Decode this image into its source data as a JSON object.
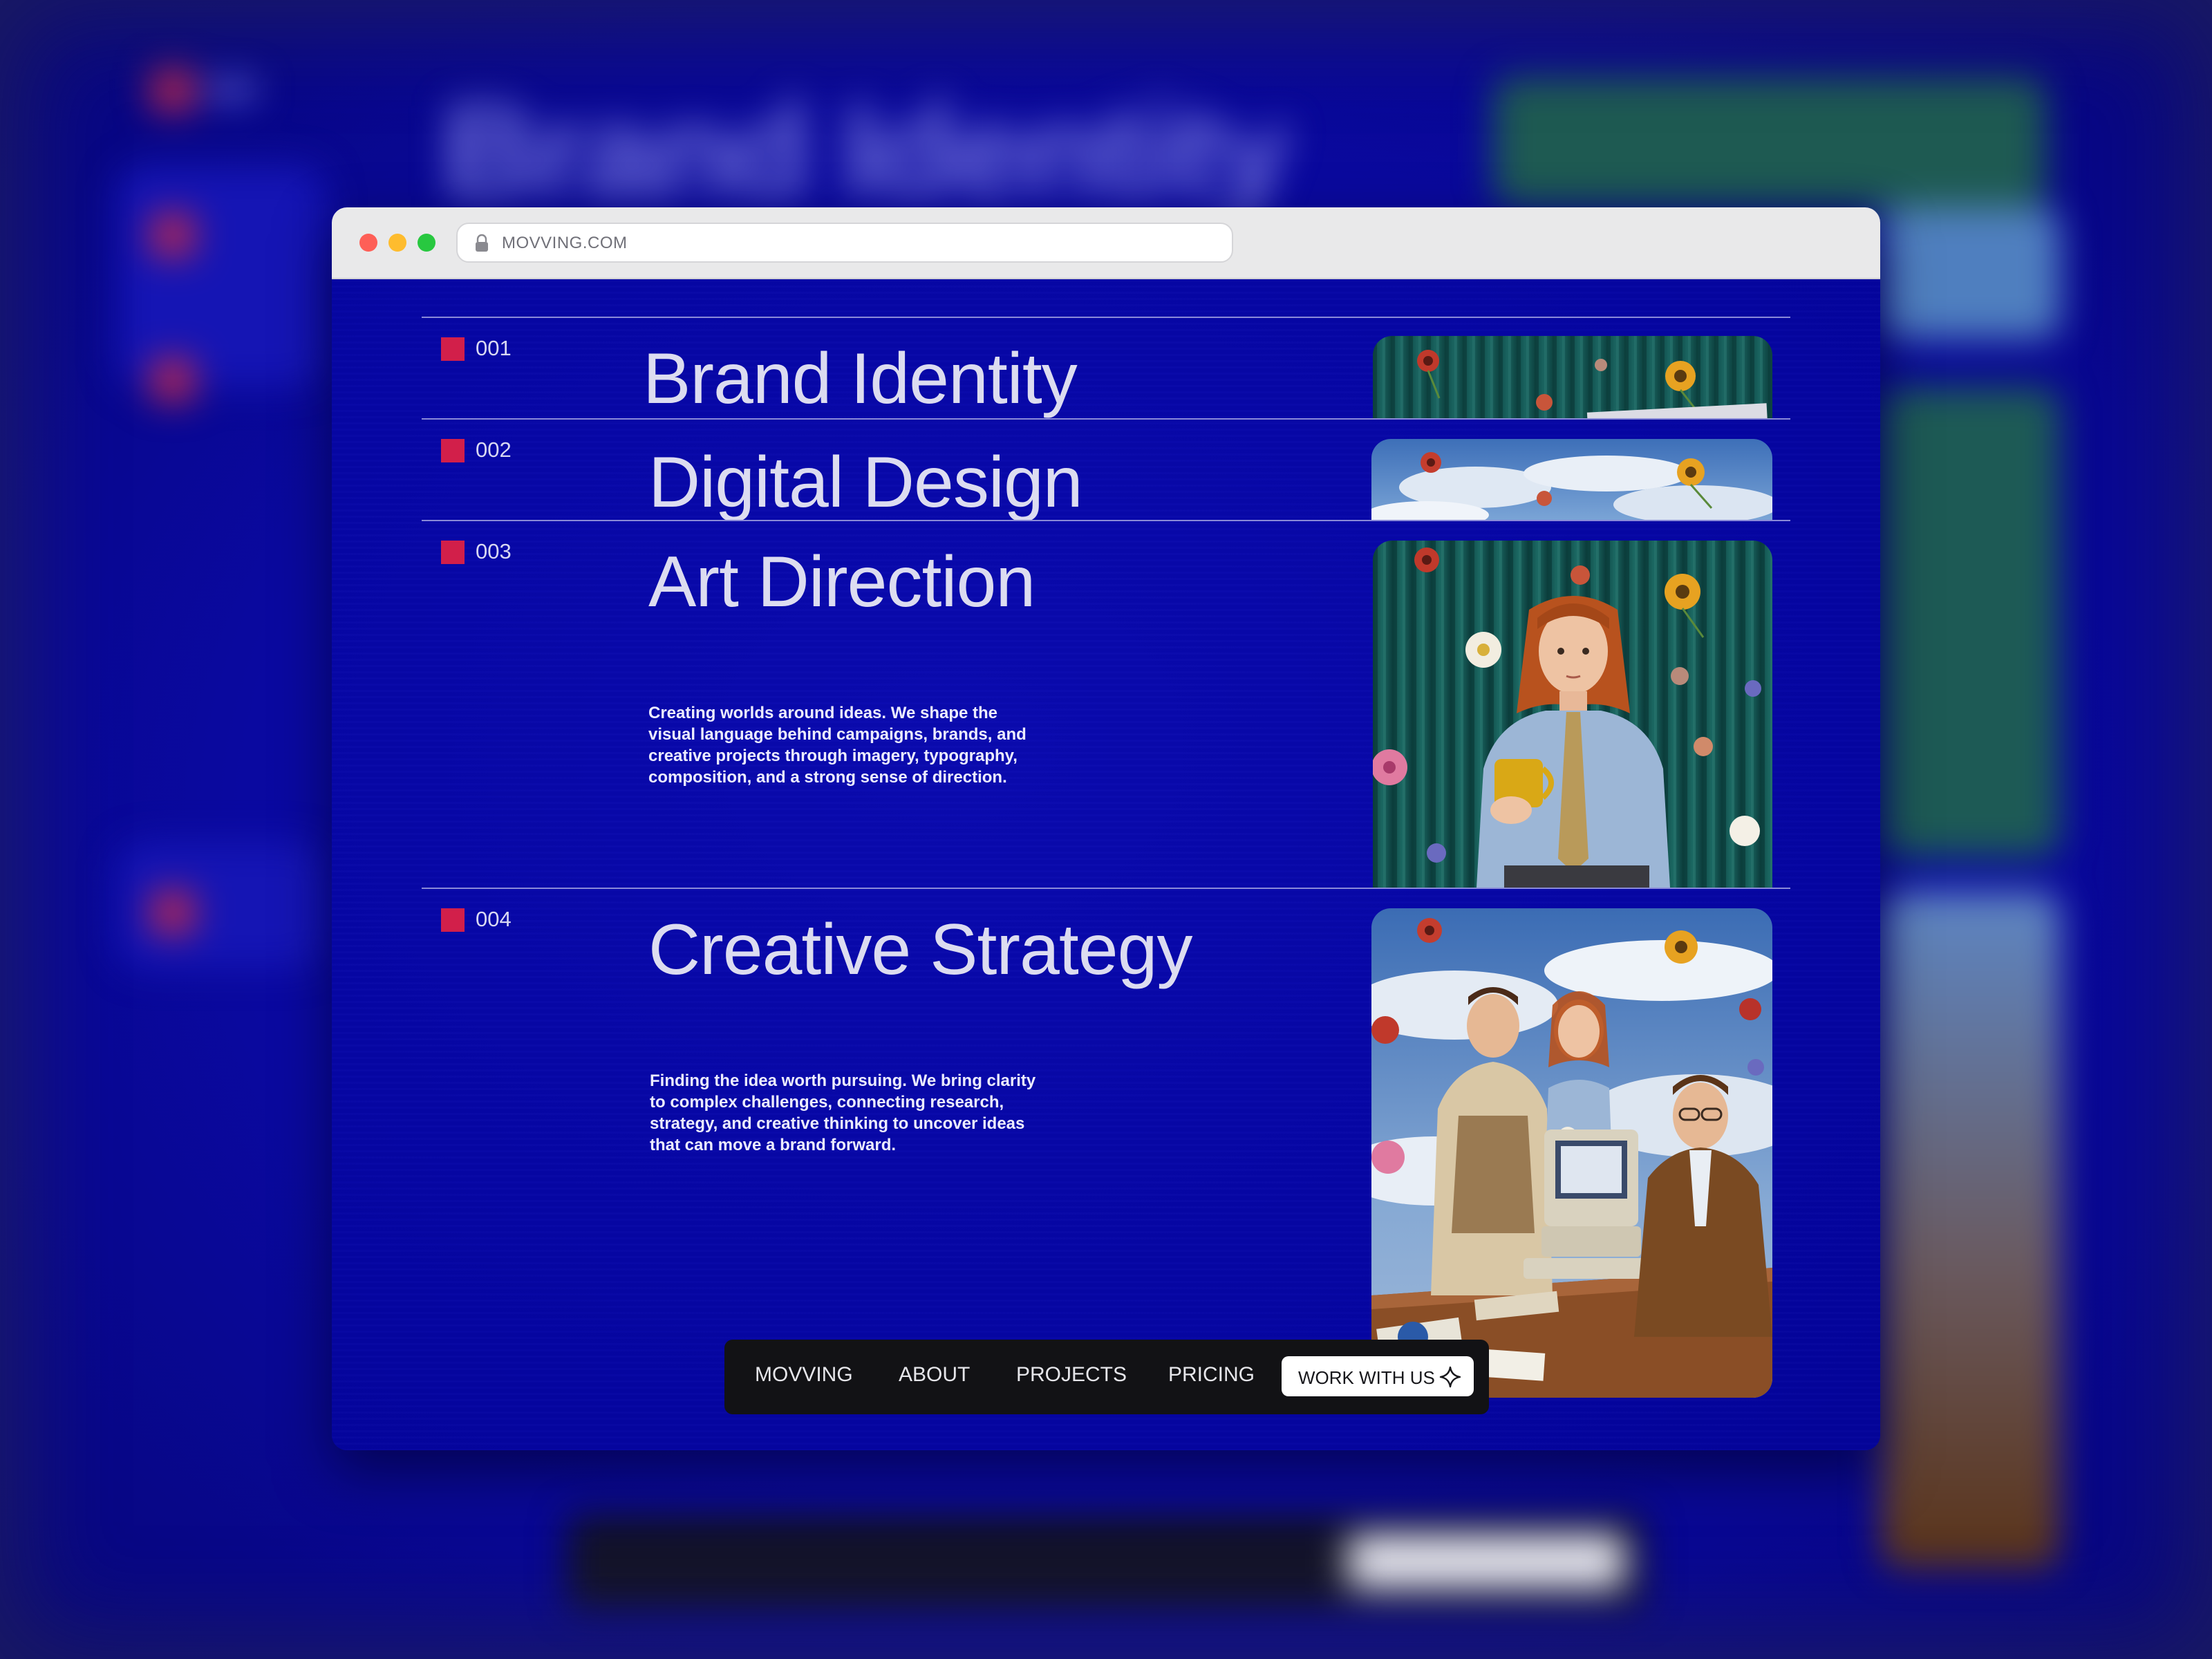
{
  "browser": {
    "url": "MOVVING.COM"
  },
  "services": [
    {
      "number": "001",
      "title": "Brand Identity",
      "description": ""
    },
    {
      "number": "002",
      "title": "Digital Design",
      "description": ""
    },
    {
      "number": "003",
      "title": "Art Direction",
      "description": "Creating worlds around ideas. We shape the visual language behind campaigns, brands, and creative projects through imagery, typography, composition, and a strong sense of direction."
    },
    {
      "number": "004",
      "title": "Creative Strategy",
      "description": "Finding the idea worth pursuing. We bring clarity to complex challenges, connecting research, strategy, and creative thinking to uncover ideas that can move a brand forward."
    }
  ],
  "nav": {
    "brand": "MOVVING",
    "about": "ABOUT",
    "projects": "PROJECTS",
    "pricing": "PRICING",
    "cta": "WORK WITH US"
  },
  "colors": {
    "page_background": "#0606a6",
    "accent_square": "#d21f4a",
    "title_text": "#dcdcf0",
    "nav_background": "#121215"
  },
  "icons": {
    "lock": "lock-icon",
    "cta": "sparkle-icon"
  }
}
